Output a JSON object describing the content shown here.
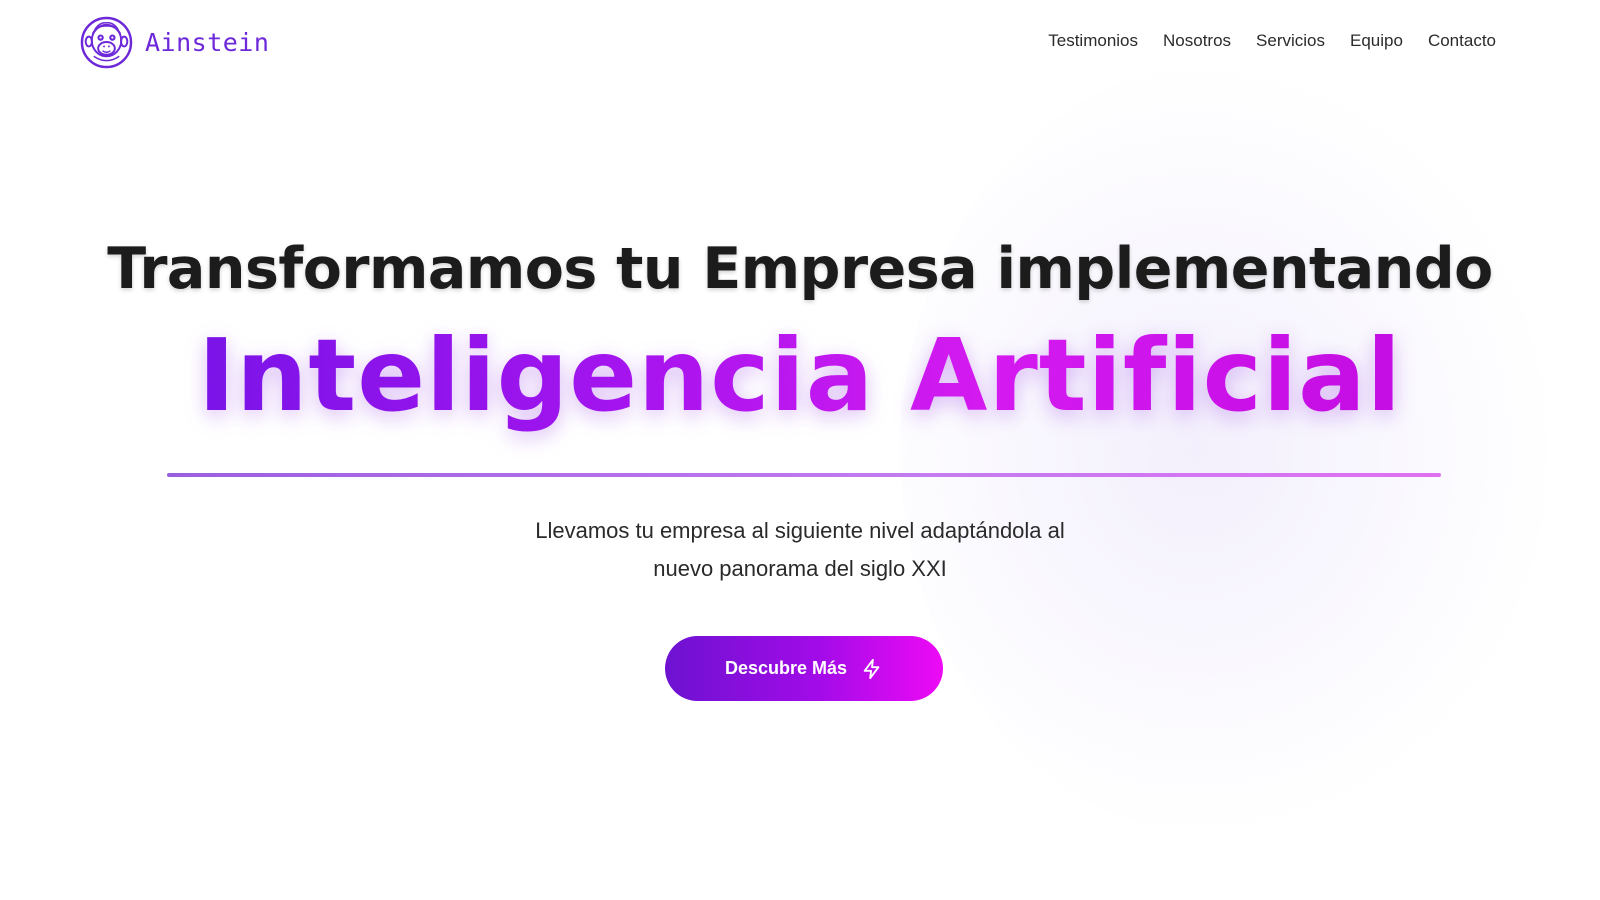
{
  "header": {
    "logo_text": "Ainstein",
    "logo_icon": "monkey-face-icon",
    "nav": [
      "Testimonios",
      "Nosotros",
      "Servicios",
      "Equipo",
      "Contacto"
    ]
  },
  "hero": {
    "title": "Transformamos tu Empresa implementando",
    "highlight": "Inteligencia Artificial",
    "subtitle_line1": "Llevamos tu empresa al siguiente nivel adaptándola al",
    "subtitle_line2": "nuevo panorama del siglo XXI",
    "cta_label": "Descubre Más",
    "cta_icon": "lightning-bolt-icon"
  },
  "colors": {
    "brand": "#6d28d9",
    "accent_start": "#7a14e8",
    "accent_end": "#ee0af5",
    "text": "#1c1c1c"
  }
}
